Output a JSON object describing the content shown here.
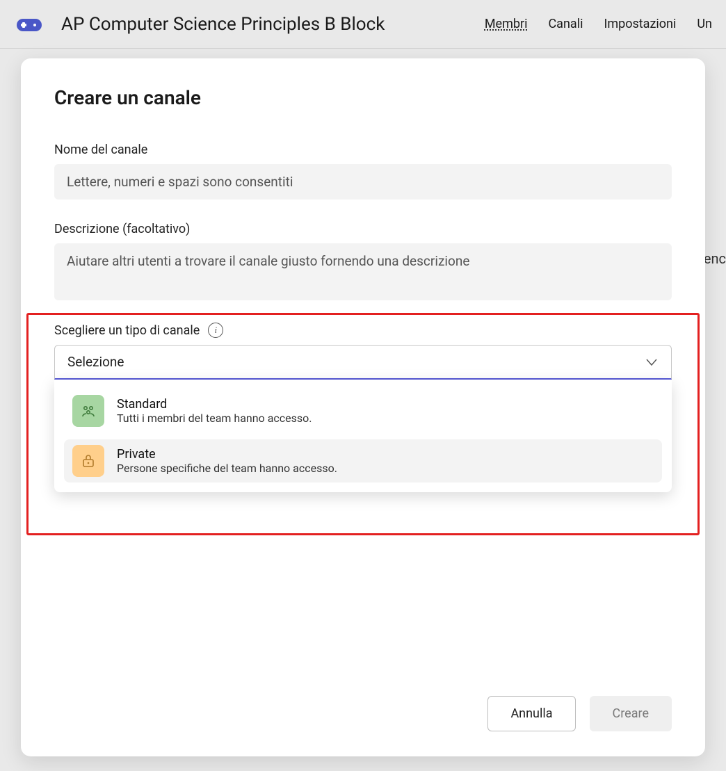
{
  "topbar": {
    "team_title": "AP Computer Science Principles B Block",
    "tabs": {
      "members": "Membri",
      "channels": "Canali",
      "settings": "Impostazioni",
      "extra": "Un"
    }
  },
  "bg_fragment": "enc",
  "modal": {
    "title": "Creare un canale",
    "name_label": "Nome del canale",
    "name_placeholder": "Lettere, numeri e spazi sono consentiti",
    "desc_label": "Descrizione (facoltativo)",
    "desc_placeholder": "Aiutare altri utenti a trovare il canale giusto fornendo una descrizione",
    "type_label": "Scegliere un tipo di canale",
    "select_placeholder": "Selezione",
    "options": {
      "standard": {
        "title": "Standard",
        "desc": "Tutti i membri del team hanno accesso."
      },
      "private": {
        "title": "Private",
        "desc": "Persone specifiche del team hanno accesso."
      }
    },
    "cancel_label": "Annulla",
    "create_label": "Creare"
  },
  "colors": {
    "highlight": "#e32020",
    "select_border": "#5558d6",
    "standard_bg": "#a7d6a2",
    "private_bg": "#ffcf8b"
  }
}
